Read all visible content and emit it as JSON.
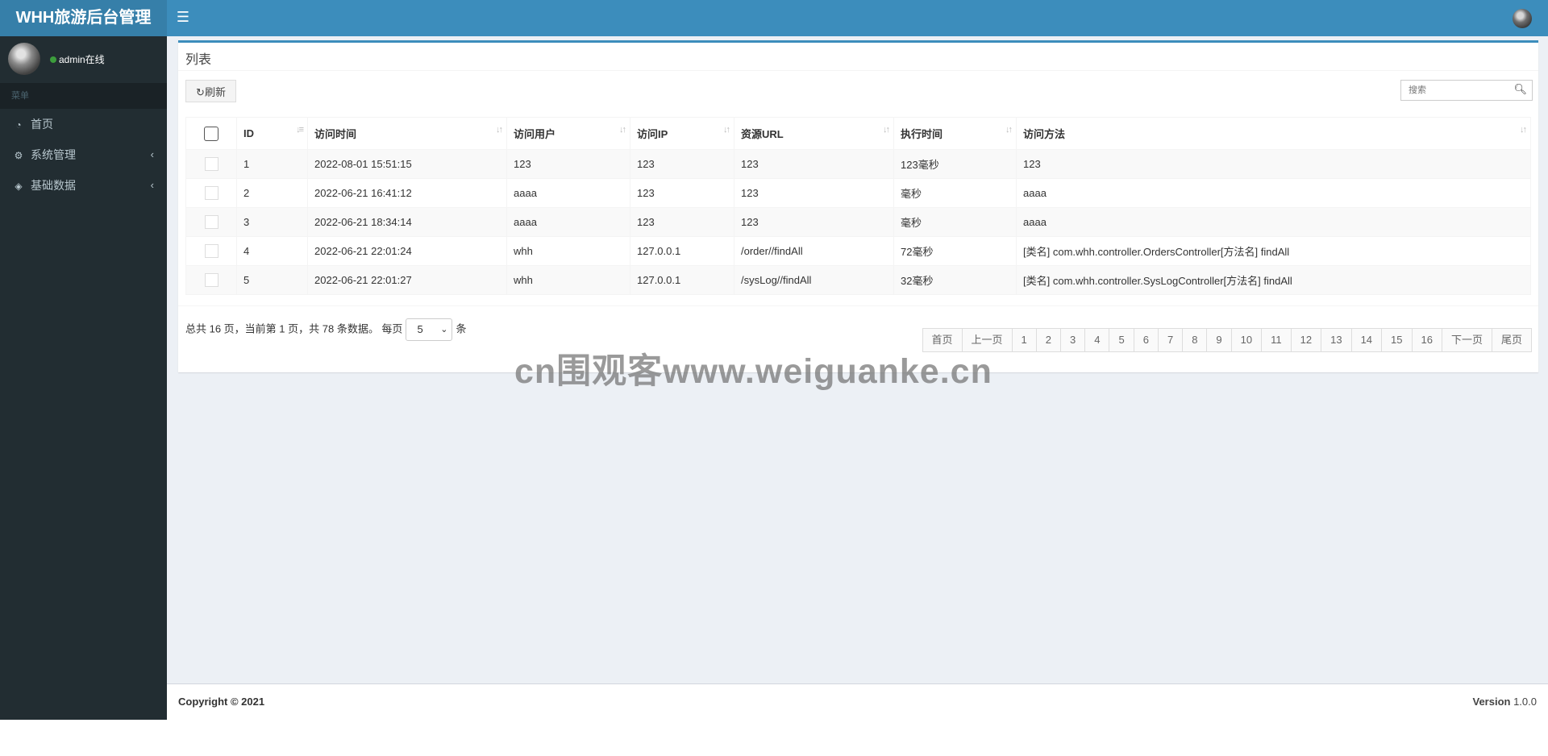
{
  "header": {
    "logo": "WHH旅游后台管理",
    "menu_toggle_icon": "bars-icon"
  },
  "sidebar": {
    "user_status": "admin在线",
    "menu_header": "菜单",
    "items": [
      {
        "label": "首页",
        "icon": "dashboard-icon"
      },
      {
        "label": "系统管理",
        "icon": "cogs-icon"
      },
      {
        "label": "基础数据",
        "icon": "cube-icon"
      }
    ]
  },
  "box": {
    "title": "列表",
    "refresh_label": "刷新",
    "search_placeholder": "搜索"
  },
  "table": {
    "columns": [
      "ID",
      "访问时间",
      "访问用户",
      "访问IP",
      "资源URL",
      "执行时间",
      "访问方法"
    ],
    "rows": [
      [
        "1",
        "2022-08-01 15:51:15",
        "123",
        "123",
        "123",
        "123毫秒",
        "123"
      ],
      [
        "2",
        "2022-06-21 16:41:12",
        "aaaa",
        "123",
        "123",
        "毫秒",
        "aaaa"
      ],
      [
        "3",
        "2022-06-21 18:34:14",
        "aaaa",
        "123",
        "123",
        "毫秒",
        "aaaa"
      ],
      [
        "4",
        "2022-06-21 22:01:24",
        "whh",
        "127.0.0.1",
        "/order//findAll",
        "72毫秒",
        "[类名] com.whh.controller.OrdersController[方法名] findAll"
      ],
      [
        "5",
        "2022-06-21 22:01:27",
        "whh",
        "127.0.0.1",
        "/sysLog//findAll",
        "32毫秒",
        "[类名] com.whh.controller.SysLogController[方法名] findAll"
      ]
    ]
  },
  "pagination": {
    "info_prefix": "总共 16 页，当前第 1 页，共 78 条数据。 每页",
    "page_size": "5",
    "info_suffix": "条",
    "first": "首页",
    "prev": "上一页",
    "pages": [
      "1",
      "2",
      "3",
      "4",
      "5",
      "6",
      "7",
      "8",
      "9",
      "10",
      "11",
      "12",
      "13",
      "14",
      "15",
      "16"
    ],
    "next": "下一页",
    "last": "尾页"
  },
  "watermark": "cn围观客www.weiguanke.cn",
  "footer": {
    "copyright": "Copyright © 2021",
    "version_label": "Version",
    "version_value": "1.0.0"
  },
  "colors": {
    "topbar": "#3c8dbc",
    "logo_bg": "#367fa9",
    "sidebar": "#222d32",
    "content_bg": "#ecf0f5"
  }
}
